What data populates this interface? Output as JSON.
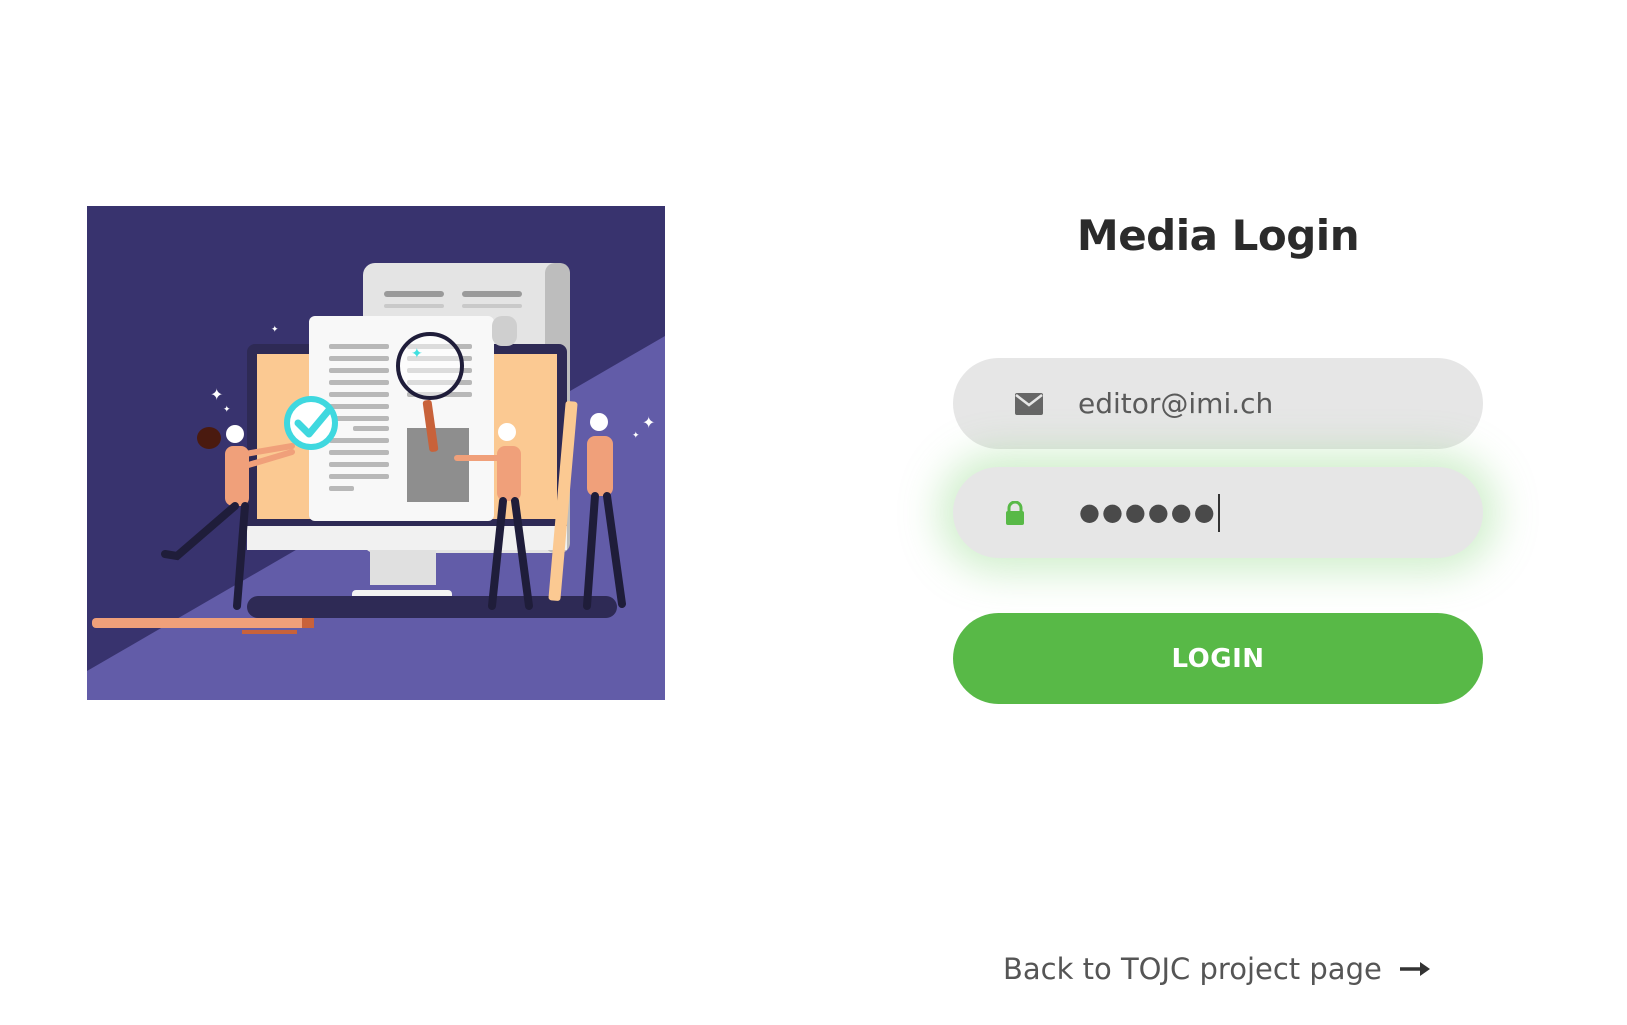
{
  "title": "Media Login",
  "email_field": {
    "icon": "envelope-icon",
    "value": "editor@imi.ch"
  },
  "password_field": {
    "icon": "lock-icon",
    "value": "●●●●●●"
  },
  "login_button": {
    "label": "LOGIN"
  },
  "back_link": {
    "label": "Back to TOJC project page",
    "icon": "arrow-right-icon"
  },
  "colors": {
    "accent": "#58b947",
    "field_bg": "#e6e6e6",
    "title": "#2b2b2b",
    "illustration_dark": "#38336e",
    "illustration_light": "#625ca8"
  }
}
